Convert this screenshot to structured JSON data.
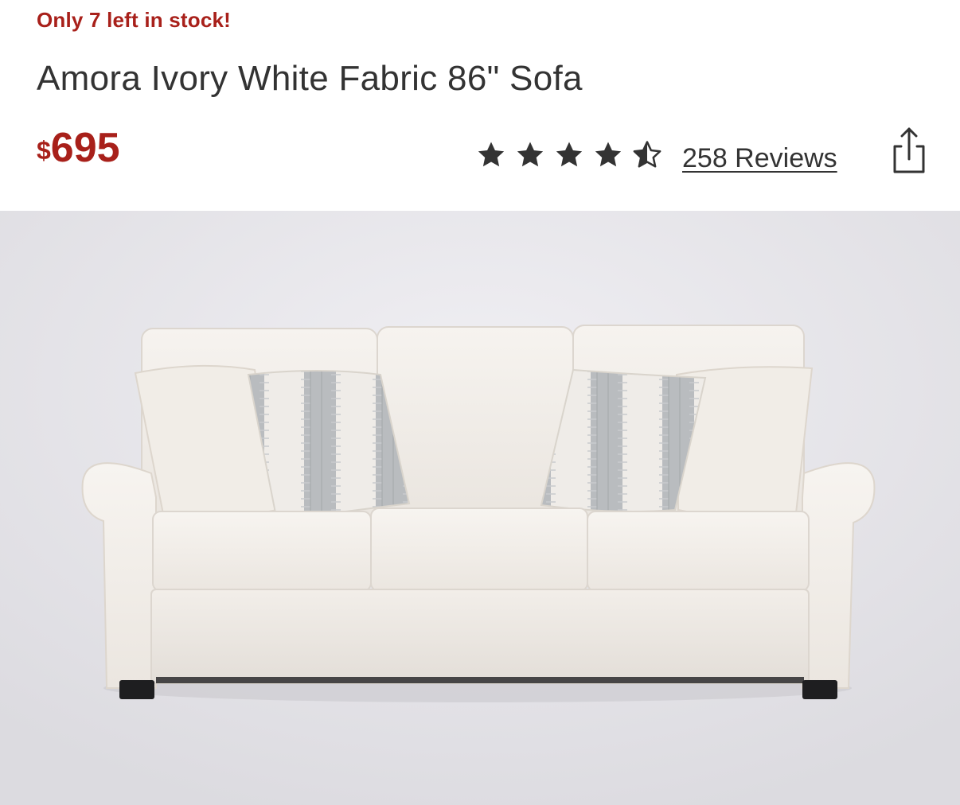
{
  "product": {
    "stock_alert": "Only 7 left in stock!",
    "title": "Amora Ivory White Fabric 86\" Sofa",
    "price_currency": "$",
    "price_amount": "695",
    "rating_value": 4.5,
    "rating_max": 5,
    "reviews_label": "258 Reviews"
  },
  "icons": {
    "star": "star-icon",
    "half_star": "half-star-icon",
    "share": "share-icon"
  },
  "colors": {
    "accent": "#a8201a",
    "text": "#333333",
    "star": "#333333",
    "image_background": "#e8e7eb",
    "sofa_fabric": "#f1ede8"
  },
  "image": {
    "name": "sofa-product-image"
  }
}
